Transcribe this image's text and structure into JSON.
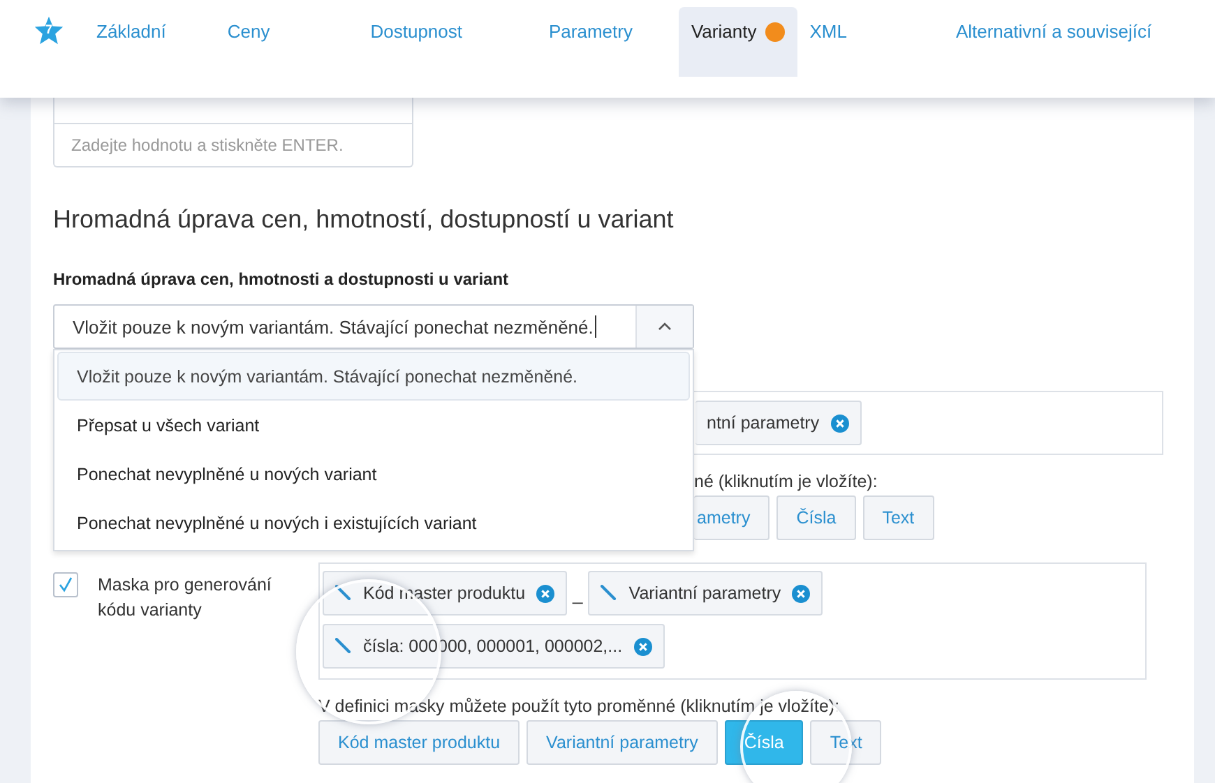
{
  "header": {
    "badge": "7",
    "tabs": [
      {
        "label": "Základní",
        "selected": false,
        "alert": false
      },
      {
        "label": "Ceny",
        "selected": false,
        "alert": false
      },
      {
        "label": "Dostupnost",
        "selected": false,
        "alert": false
      },
      {
        "label": "Parametry",
        "selected": false,
        "alert": false
      },
      {
        "label": "Varianty",
        "selected": true,
        "alert": true
      },
      {
        "label": "XML",
        "selected": false,
        "alert": false
      },
      {
        "label": "Alternativní a související",
        "selected": false,
        "alert": false
      }
    ]
  },
  "value_input": {
    "placeholder": "Zadejte hodnotu a stiskněte ENTER."
  },
  "section_title": "Hromadná úprava cen, hmotností, dostupností u variant",
  "bulk_edit": {
    "label": "Hromadná úprava cen, hmotnosti a dostupnosti u variant",
    "value": "Vložit pouze k novým variantám. Stávající ponechat nezměněné.",
    "expanded": true,
    "options": [
      {
        "label": "Vložit pouze k novým variantám. Stávající ponechat nezměněné.",
        "selected": true
      },
      {
        "label": "Přepsat u všech variant",
        "selected": false
      },
      {
        "label": "Ponechat nevyplněné u nových variant",
        "selected": false
      },
      {
        "label": "Ponechat nevyplněné u nových i existujících variant",
        "selected": false
      }
    ]
  },
  "covered_row": {
    "tags": [
      "ntní parametry"
    ],
    "hint": "né (kliknutím je vložíte):",
    "variables": [
      {
        "label": "ametry",
        "selected": false
      },
      {
        "label": "Čísla",
        "selected": false
      },
      {
        "label": "Text",
        "selected": false
      }
    ]
  },
  "mask": {
    "checked": true,
    "label": "Maska pro generování kódu varianty",
    "tags": [
      {
        "kind": "tag",
        "label": "Kód master produktu"
      },
      {
        "kind": "separator",
        "label": "_"
      },
      {
        "kind": "tag",
        "label": "Variantní parametry"
      },
      {
        "kind": "tag",
        "label": "čísla: 000000, 000001, 000002,..."
      }
    ],
    "hint": "V definici masky můžete použít tyto proměnné (kliknutím je vložíte):",
    "variables": [
      {
        "label": "Kód master produktu",
        "selected": false
      },
      {
        "label": "Variantní parametry",
        "selected": false
      },
      {
        "label": "Čísla",
        "selected": true
      },
      {
        "label": "Text",
        "selected": false
      }
    ]
  }
}
